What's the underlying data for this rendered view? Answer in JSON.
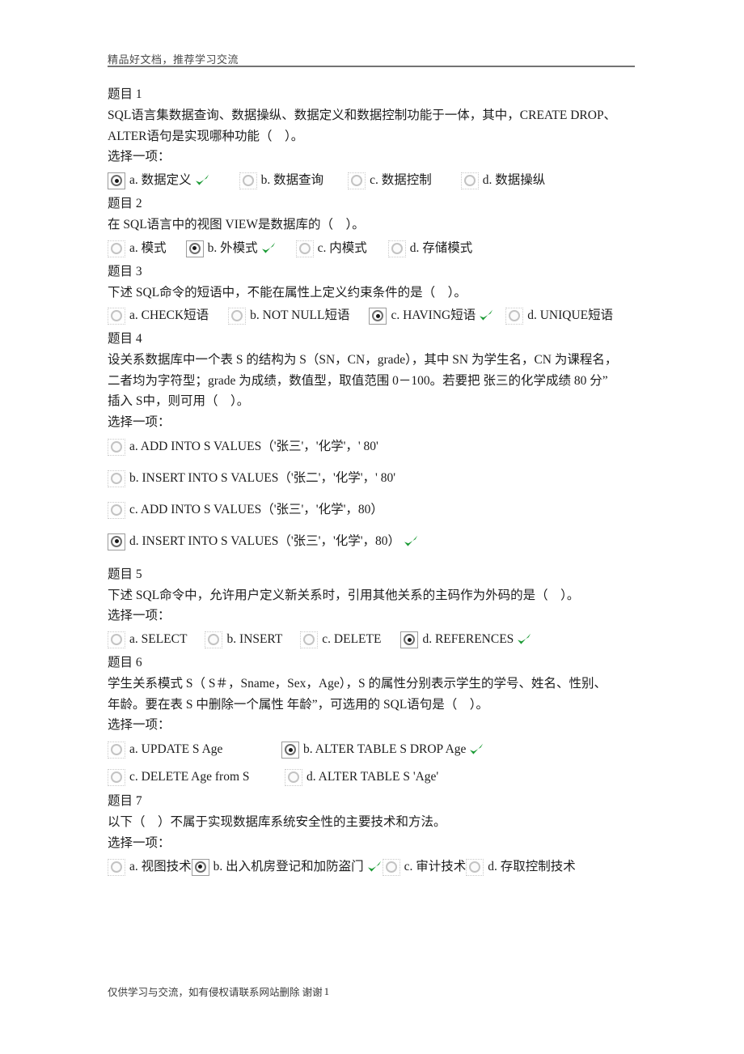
{
  "header": {
    "watermark_text": "精品好文档，推荐学习交流"
  },
  "footer": {
    "note": "仅供学习与交流，如有侵权请联系网站删除  谢谢",
    "page_number": "1"
  },
  "ui": {
    "choose_one_label": "选择一项：",
    "correct_color": "#1a9a34",
    "text_color": "#1d1d1d"
  },
  "questions": [
    {
      "number_label": "题目 1",
      "text_lines": [
        "SQL语言集数据查询、数据操纵、数据定义和数据控制功能于一体，其中，CREATE DROP、",
        "ALTER语句是实现哪种功能（　）。"
      ],
      "has_prompt": true,
      "layout": "row",
      "options": [
        {
          "label": "a. 数据定义",
          "selected": true,
          "correct": true
        },
        {
          "label": "b. 数据查询",
          "selected": false,
          "correct": false
        },
        {
          "label": "c. 数据控制",
          "selected": false,
          "correct": false
        },
        {
          "label": "d. 数据操纵",
          "selected": false,
          "correct": false
        }
      ]
    },
    {
      "number_label": "题目 2",
      "text_lines": [
        "在 SQL语言中的视图 VIEW是数据库的（　）。"
      ],
      "has_prompt": false,
      "layout": "row",
      "options": [
        {
          "label": "a. 模式",
          "selected": false,
          "correct": false
        },
        {
          "label": "b. 外模式",
          "selected": true,
          "correct": true
        },
        {
          "label": "c. 内模式",
          "selected": false,
          "correct": false
        },
        {
          "label": "d. 存储模式",
          "selected": false,
          "correct": false
        }
      ]
    },
    {
      "number_label": "题目 3",
      "text_lines": [
        "下述 SQL命令的短语中，不能在属性上定义约束条件的是（　）。"
      ],
      "has_prompt": false,
      "layout": "row",
      "options": [
        {
          "label": "a. CHECK短语",
          "selected": false,
          "correct": false
        },
        {
          "label": "b. NOT NULL短语",
          "selected": false,
          "correct": false
        },
        {
          "label": "c. HAVING短语",
          "selected": true,
          "correct": true
        },
        {
          "label": "d. UNIQUE短语",
          "selected": false,
          "correct": false
        }
      ]
    },
    {
      "number_label": "题目 4",
      "text_lines": [
        "设关系数据库中一个表 S 的结构为 S（SN，CN，grade），其中 SN 为学生名，CN 为课程名，",
        "二者均为字符型；grade 为成绩，数值型，取值范围 0－100。若要把 张三的化学成绩 80 分”",
        "插入 S中，则可用（　）。"
      ],
      "has_prompt": true,
      "layout": "column",
      "options": [
        {
          "label": "a. ADD INTO S VALUES（'张三'，'化学'，' 80'",
          "selected": false,
          "correct": false
        },
        {
          "label": "b. INSERT INTO S VALUES（'张二'，'化学'，' 80'",
          "selected": false,
          "correct": false
        },
        {
          "label": "c. ADD INTO S VALUES（'张三'，'化学'，80）",
          "selected": false,
          "correct": false
        },
        {
          "label": "d. INSERT INTO S VALUES（'张三'，'化学'，80）",
          "selected": true,
          "correct": true
        }
      ]
    },
    {
      "number_label": "题目 5",
      "text_lines": [
        "下述 SQL命令中，允许用户定义新关系时，引用其他关系的主码作为外码的是（　）。"
      ],
      "has_prompt": true,
      "layout": "row",
      "options": [
        {
          "label": "a. SELECT",
          "selected": false,
          "correct": false
        },
        {
          "label": "b. INSERT",
          "selected": false,
          "correct": false
        },
        {
          "label": "c. DELETE",
          "selected": false,
          "correct": false
        },
        {
          "label": "d. REFERENCES",
          "selected": true,
          "correct": true
        }
      ]
    },
    {
      "number_label": "题目 6",
      "text_lines": [
        "学生关系模式 S（ S＃，Sname，Sex，Age），S 的属性分别表示学生的学号、姓名、性别、",
        "年龄。要在表 S 中删除一个属性 年龄”，可选用的 SQL语句是（　）。"
      ],
      "has_prompt": true,
      "layout": "grid2",
      "options": [
        {
          "label": "a. UPDATE S Age",
          "selected": false,
          "correct": false
        },
        {
          "label": "b. ALTER TABLE S DROP Age",
          "selected": true,
          "correct": true
        },
        {
          "label": "c. DELETE Age from S",
          "selected": false,
          "correct": false
        },
        {
          "label": "d. ALTER TABLE S  'Age'",
          "selected": false,
          "correct": false
        }
      ]
    },
    {
      "number_label": "题目 7",
      "text_lines": [
        "以下（　）不属于实现数据库系统安全性的主要技术和方法。"
      ],
      "has_prompt": true,
      "layout": "row",
      "options": [
        {
          "label": "a. 视图技术",
          "selected": false,
          "correct": false
        },
        {
          "label": "b. 出入机房登记和加防盗门",
          "selected": true,
          "correct": true
        },
        {
          "label": "c. 审计技术",
          "selected": false,
          "correct": false
        },
        {
          "label": "d. 存取控制技术",
          "selected": false,
          "correct": false
        }
      ]
    }
  ]
}
